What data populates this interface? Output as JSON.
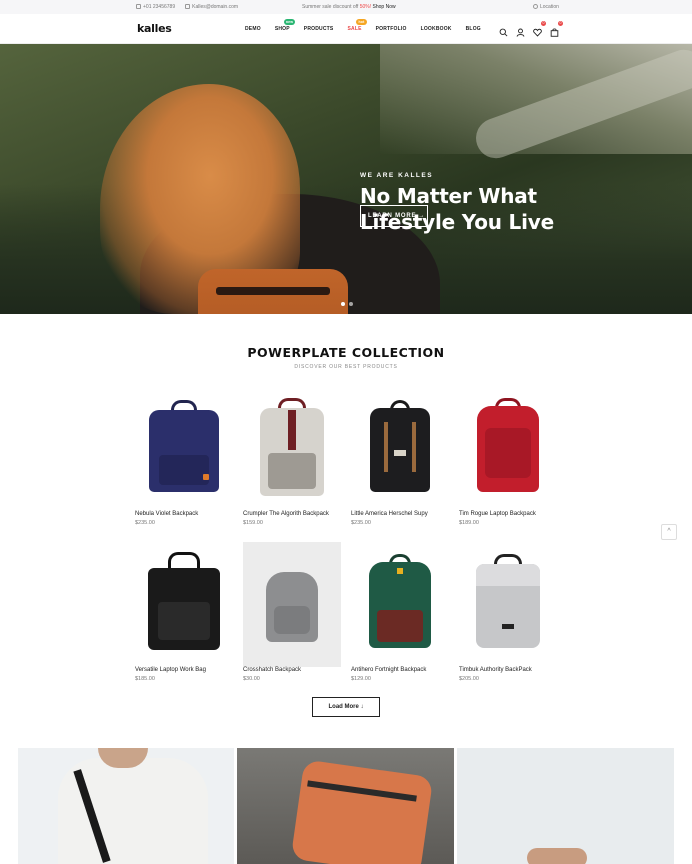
{
  "topbar": {
    "phone": "+01 23456789",
    "email": "Kalles@domain.com",
    "promo_prefix": "Summer sale discount off",
    "promo_pct": "50%!",
    "promo_link": "Shop Now",
    "location": "Location"
  },
  "header": {
    "logo": "kalles",
    "nav": [
      {
        "label": "DEMO"
      },
      {
        "label": "SHOP",
        "badge": "new"
      },
      {
        "label": "PRODUCTS"
      },
      {
        "label": "SALE",
        "badge": "hot"
      },
      {
        "label": "PORTFOLIO"
      },
      {
        "label": "LOOKBOOK"
      },
      {
        "label": "BLOG"
      }
    ],
    "wishlist_count": "0",
    "cart_count": "0",
    "icons": [
      "search-icon",
      "user-icon",
      "heart-icon",
      "bag-icon"
    ]
  },
  "hero": {
    "eyebrow": "WE ARE KALLES",
    "title_line1": "No Matter What",
    "title_line2": "Lifestyle You Live",
    "cta": "LEARN MORE",
    "cta_icon": "→"
  },
  "collection": {
    "title": "POWERPLATE COLLECTION",
    "subtitle": "DISCOVER OUR BEST PRODUCTS",
    "products": [
      {
        "name": "Nebula Violet Backpack",
        "price": "$235.00",
        "color": "#2b2f6b"
      },
      {
        "name": "Crumpler The Algorith Backpack",
        "price": "$159.00",
        "color": "#c9c6c0"
      },
      {
        "name": "Little America Herschel Supy",
        "price": "$235.00",
        "color": "#1d1d1f"
      },
      {
        "name": "Tim Rogue Laptop Backpack",
        "price": "$189.00",
        "color": "#c21e2c"
      },
      {
        "name": "Versatile Laptop Work Bag",
        "price": "$185.00",
        "color": "#1a1a1a"
      },
      {
        "name": "Crosshatch Backpack",
        "price": "$30.00",
        "color": "#8d8e90"
      },
      {
        "name": "Antihero Fortnight Backpack",
        "price": "$129.00",
        "color": "#1f5a45"
      },
      {
        "name": "Timbuk Authority BackPack",
        "price": "$205.00",
        "color": "#bfc0c2"
      }
    ],
    "load_more": "Load More",
    "load_more_icon": "↓"
  },
  "scroll_top_icon": "^"
}
